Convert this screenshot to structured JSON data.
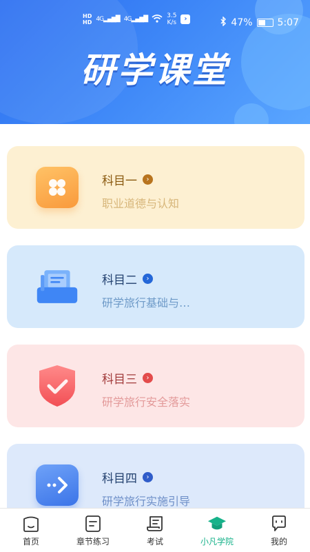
{
  "status_bar": {
    "hd1": "HD",
    "hd2": "HD",
    "signal1": "4G",
    "signal2": "4G",
    "speed_value": "3.5",
    "speed_unit": "K/s",
    "battery": "47%",
    "time": "5:07"
  },
  "header": {
    "title": "研学课堂"
  },
  "subjects": [
    {
      "title": "科目一",
      "subtitle": "职业道德与认知",
      "icon": "flower-icon",
      "color": "#f99a3c"
    },
    {
      "title": "科目二",
      "subtitle": "研学旅行基础与…",
      "icon": "file-tray-icon",
      "color": "#3f86f5"
    },
    {
      "title": "科目三",
      "subtitle": "研学旅行安全落实",
      "icon": "shield-check-icon",
      "color": "#f36565"
    },
    {
      "title": "科目四",
      "subtitle": "研学旅行实施引导",
      "icon": "arrow-right-icon",
      "color": "#3b74e8"
    }
  ],
  "tabs": [
    {
      "label": "首页",
      "icon": "home-icon"
    },
    {
      "label": "章节练习",
      "icon": "notebook-icon"
    },
    {
      "label": "考试",
      "icon": "scroll-icon"
    },
    {
      "label": "小凡学院",
      "icon": "graduation-cap-icon",
      "active": true
    },
    {
      "label": "我的",
      "icon": "profile-icon"
    }
  ],
  "colors": {
    "header_blue": "#2b6ef0",
    "active_tab": "#17b28a"
  }
}
